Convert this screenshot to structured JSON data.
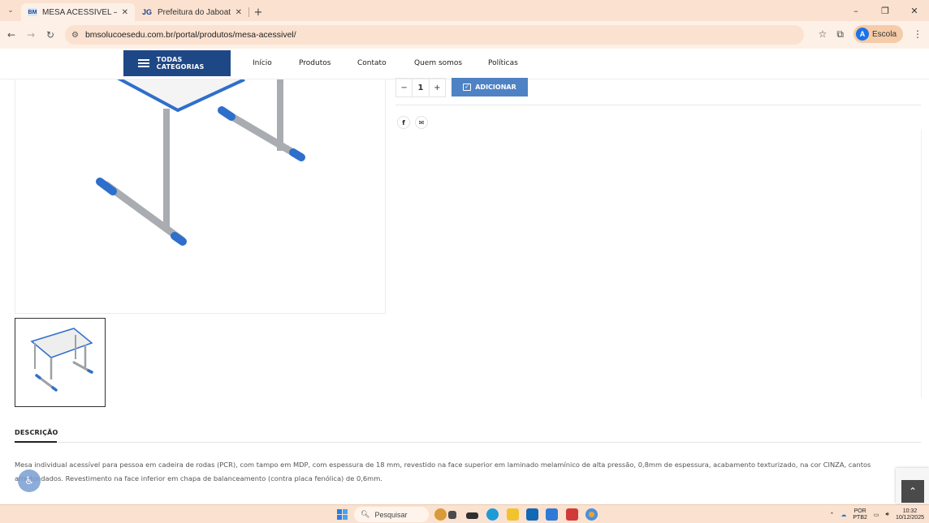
{
  "browser": {
    "tabs": [
      {
        "favicon": "BM",
        "title": "MESA ACESSÍVEL – Portal BM",
        "active": true
      },
      {
        "favicon": "JG",
        "title": "Prefeitura do Jaboatão dos Gua",
        "active": false
      }
    ],
    "url": "bmsolucoesedu.com.br/portal/produtos/mesa-acessivel/",
    "profile_initial": "A",
    "profile_label": "Escola"
  },
  "site_nav": {
    "categories_label": "TODAS CATEGORIAS",
    "items": [
      "Início",
      "Produtos",
      "Contato",
      "Quem somos",
      "Políticas"
    ]
  },
  "product": {
    "quantity": "1",
    "minus": "−",
    "plus": "+",
    "add_label": "ADICIONAR",
    "share": [
      {
        "icon": "facebook-icon",
        "glyph": "f"
      },
      {
        "icon": "email-icon",
        "glyph": "✉"
      }
    ]
  },
  "description": {
    "tab_label": "DESCRIÇÃO",
    "text": "Mesa individual acessível para pessoa em cadeira de rodas (PCR), com tampo em MDP, com espessura de 18 mm, revestido na face superior em laminado melamínico de alta pressão, 0,8mm de espessura, acabamento texturizado, na cor CINZA, cantos arredondados. Revestimento na face inferior em chapa de balanceamento (contra placa fenólica) de 0,6mm."
  },
  "taskbar": {
    "search_placeholder": "Pesquisar",
    "lang_top": "POR",
    "lang_bottom": "PTB2",
    "time": "10:32",
    "date": "10/12/2025"
  },
  "colors": {
    "brand_blue": "#1e4786",
    "add_button": "#4f82c4",
    "chrome_bg": "#fbe2d0",
    "table_blue": "#2f6fcb",
    "leg_gray": "#a9adb1"
  }
}
